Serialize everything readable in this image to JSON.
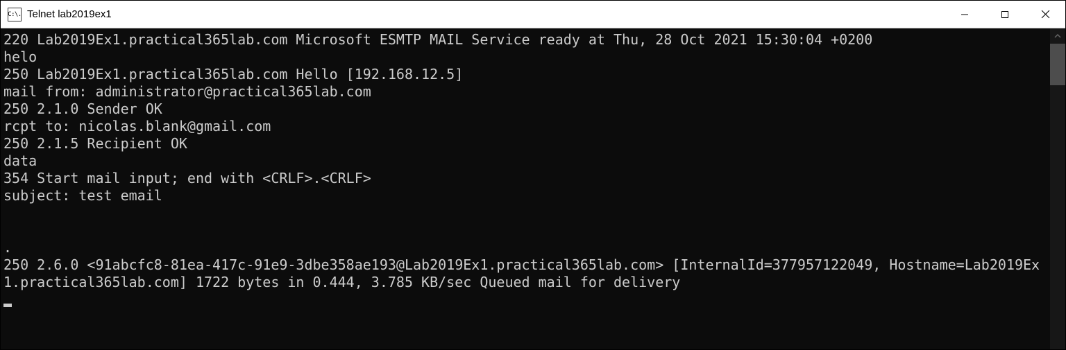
{
  "window": {
    "icon_text": "C:\\.",
    "title": "Telnet lab2019ex1"
  },
  "terminal": {
    "lines": [
      "220 Lab2019Ex1.practical365lab.com Microsoft ESMTP MAIL Service ready at Thu, 28 Oct 2021 15:30:04 +0200",
      "helo",
      "250 Lab2019Ex1.practical365lab.com Hello [192.168.12.5]",
      "mail from: administrator@practical365lab.com",
      "250 2.1.0 Sender OK",
      "rcpt to: nicolas.blank@gmail.com",
      "250 2.1.5 Recipient OK",
      "data",
      "354 Start mail input; end with <CRLF>.<CRLF>",
      "subject: test email",
      "",
      "",
      ".",
      "250 2.6.0 <91abcfc8-81ea-417c-91e9-3dbe358ae193@Lab2019Ex1.practical365lab.com> [InternalId=377957122049, Hostname=Lab2019Ex1.practical365lab.com] 1722 bytes in 0.444, 3.785 KB/sec Queued mail for delivery"
    ]
  }
}
